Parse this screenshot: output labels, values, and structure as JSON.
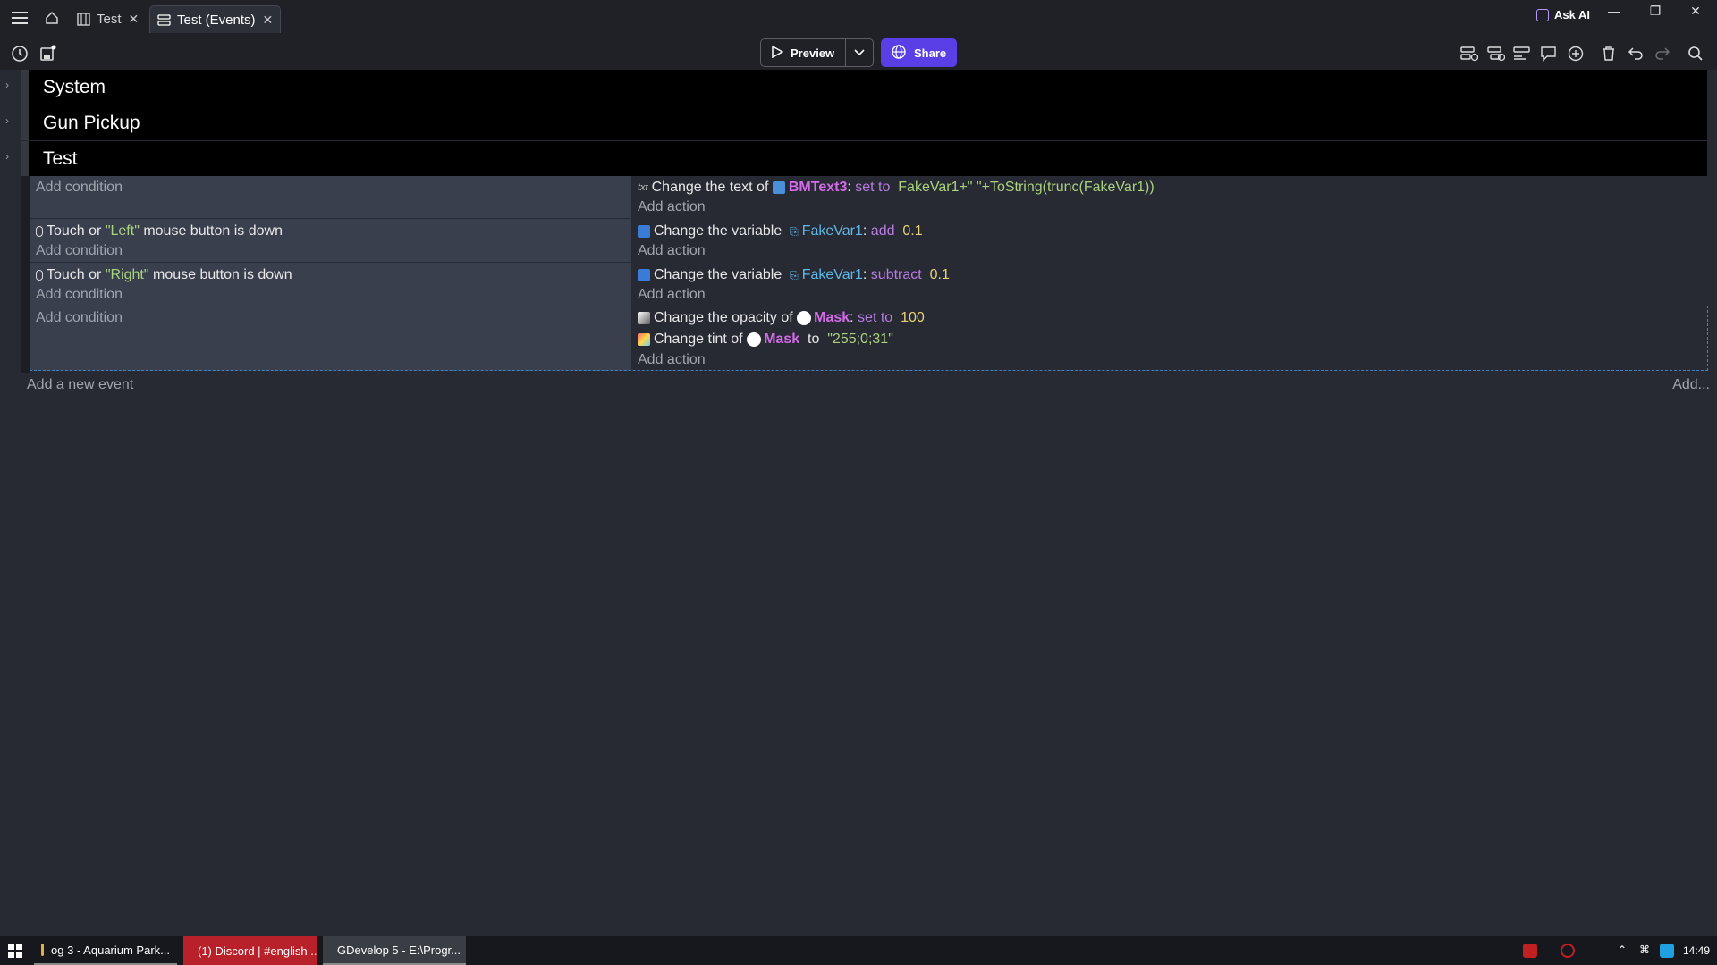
{
  "titlebar": {
    "tabs": [
      {
        "label": "Test",
        "icon": "scene-icon",
        "closable": true
      },
      {
        "label": "Test (Events)",
        "icon": "events-icon",
        "closable": true,
        "active": true
      }
    ],
    "ask_ai": "Ask AI"
  },
  "toolbar": {
    "preview_label": "Preview",
    "share_label": "Share"
  },
  "groups": [
    {
      "title": "System"
    },
    {
      "title": "Gun Pickup"
    },
    {
      "title": "Test"
    }
  ],
  "events": [
    {
      "conditions": [],
      "add_condition": "Add condition",
      "actions": [
        {
          "icon": "text-icon",
          "prefix": "Change the text of",
          "object": "BMText3",
          "op": "set to",
          "value": "FakeVar1+\" \"+ToString(trunc(FakeVar1))"
        }
      ],
      "add_action": "Add action"
    },
    {
      "conditions": [
        {
          "icon": "mouse-icon",
          "pre": "Touch or",
          "param": "\"Left\"",
          "post": "mouse button is down"
        }
      ],
      "add_condition": "Add condition",
      "actions": [
        {
          "icon": "variable-icon",
          "prefix": "Change the variable",
          "variable": "FakeVar1",
          "op": "add",
          "value": "0.1"
        }
      ],
      "add_action": "Add action"
    },
    {
      "conditions": [
        {
          "icon": "mouse-icon",
          "pre": "Touch or",
          "param": "\"Right\"",
          "post": "mouse button is down"
        }
      ],
      "add_condition": "Add condition",
      "actions": [
        {
          "icon": "variable-icon",
          "prefix": "Change the variable",
          "variable": "FakeVar1",
          "op": "subtract",
          "value": "0.1"
        }
      ],
      "add_action": "Add action"
    },
    {
      "conditions": [],
      "add_condition": "Add condition",
      "actions": [
        {
          "icon": "opacity-icon",
          "prefix": "Change the opacity of",
          "object": "Mask",
          "op": "set to",
          "value": "100"
        },
        {
          "icon": "tint-icon",
          "prefix": "Change tint of",
          "object": "Mask",
          "op": "to",
          "value": "\"255;0;31\""
        }
      ],
      "add_action": "Add action"
    }
  ],
  "footer": {
    "add_event": "Add a new event",
    "add_more": "Add..."
  },
  "taskbar": {
    "items": [
      {
        "label": "og 3 - Aquarium Park...",
        "icon": "game-icon"
      },
      {
        "label": "(1) Discord | #english ...",
        "icon": "discord-icon"
      },
      {
        "label": "GDevelop 5 - E:\\Progr...",
        "icon": "gdevelop-icon"
      }
    ],
    "clock": "14:49"
  },
  "colors": {
    "accent": "#5a3fe6",
    "background": "#272a33",
    "condition_bg": "#3a3f4d",
    "group_bg": "#000000"
  }
}
